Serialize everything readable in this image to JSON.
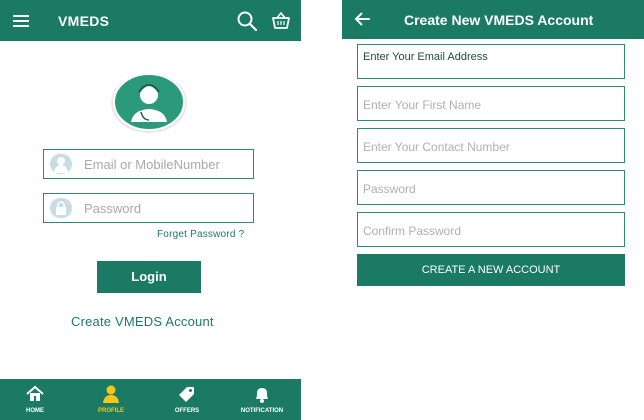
{
  "login_screen": {
    "app_title": "VMEDS",
    "email_placeholder": "Email or MobileNumber",
    "password_placeholder": "Password",
    "forgot_password": "Forget Password ?",
    "login_button": "Login",
    "create_account_link": "Create VMEDS Account",
    "nav": [
      {
        "label": "HOME",
        "icon": "home-icon"
      },
      {
        "label": "PROFILE",
        "icon": "profile-icon"
      },
      {
        "label": "OFFERS",
        "icon": "offers-tag-icon"
      },
      {
        "label": "NOTIFICATION",
        "icon": "bell-icon"
      }
    ],
    "active_nav": "PROFILE"
  },
  "register_screen": {
    "title": "Create New VMEDS Account",
    "fields": [
      {
        "placeholder": "Enter Your Email Address"
      },
      {
        "placeholder": "Enter Your First Name"
      },
      {
        "placeholder": "Enter Your Contact Number"
      },
      {
        "placeholder": "Password"
      },
      {
        "placeholder": "Confirm Password"
      }
    ],
    "submit_button": "CREATE A NEW ACCOUNT"
  },
  "colors": {
    "primary": "#1a7a63",
    "active_nav": "#f5c71a",
    "field_border": "#2b8d74"
  }
}
